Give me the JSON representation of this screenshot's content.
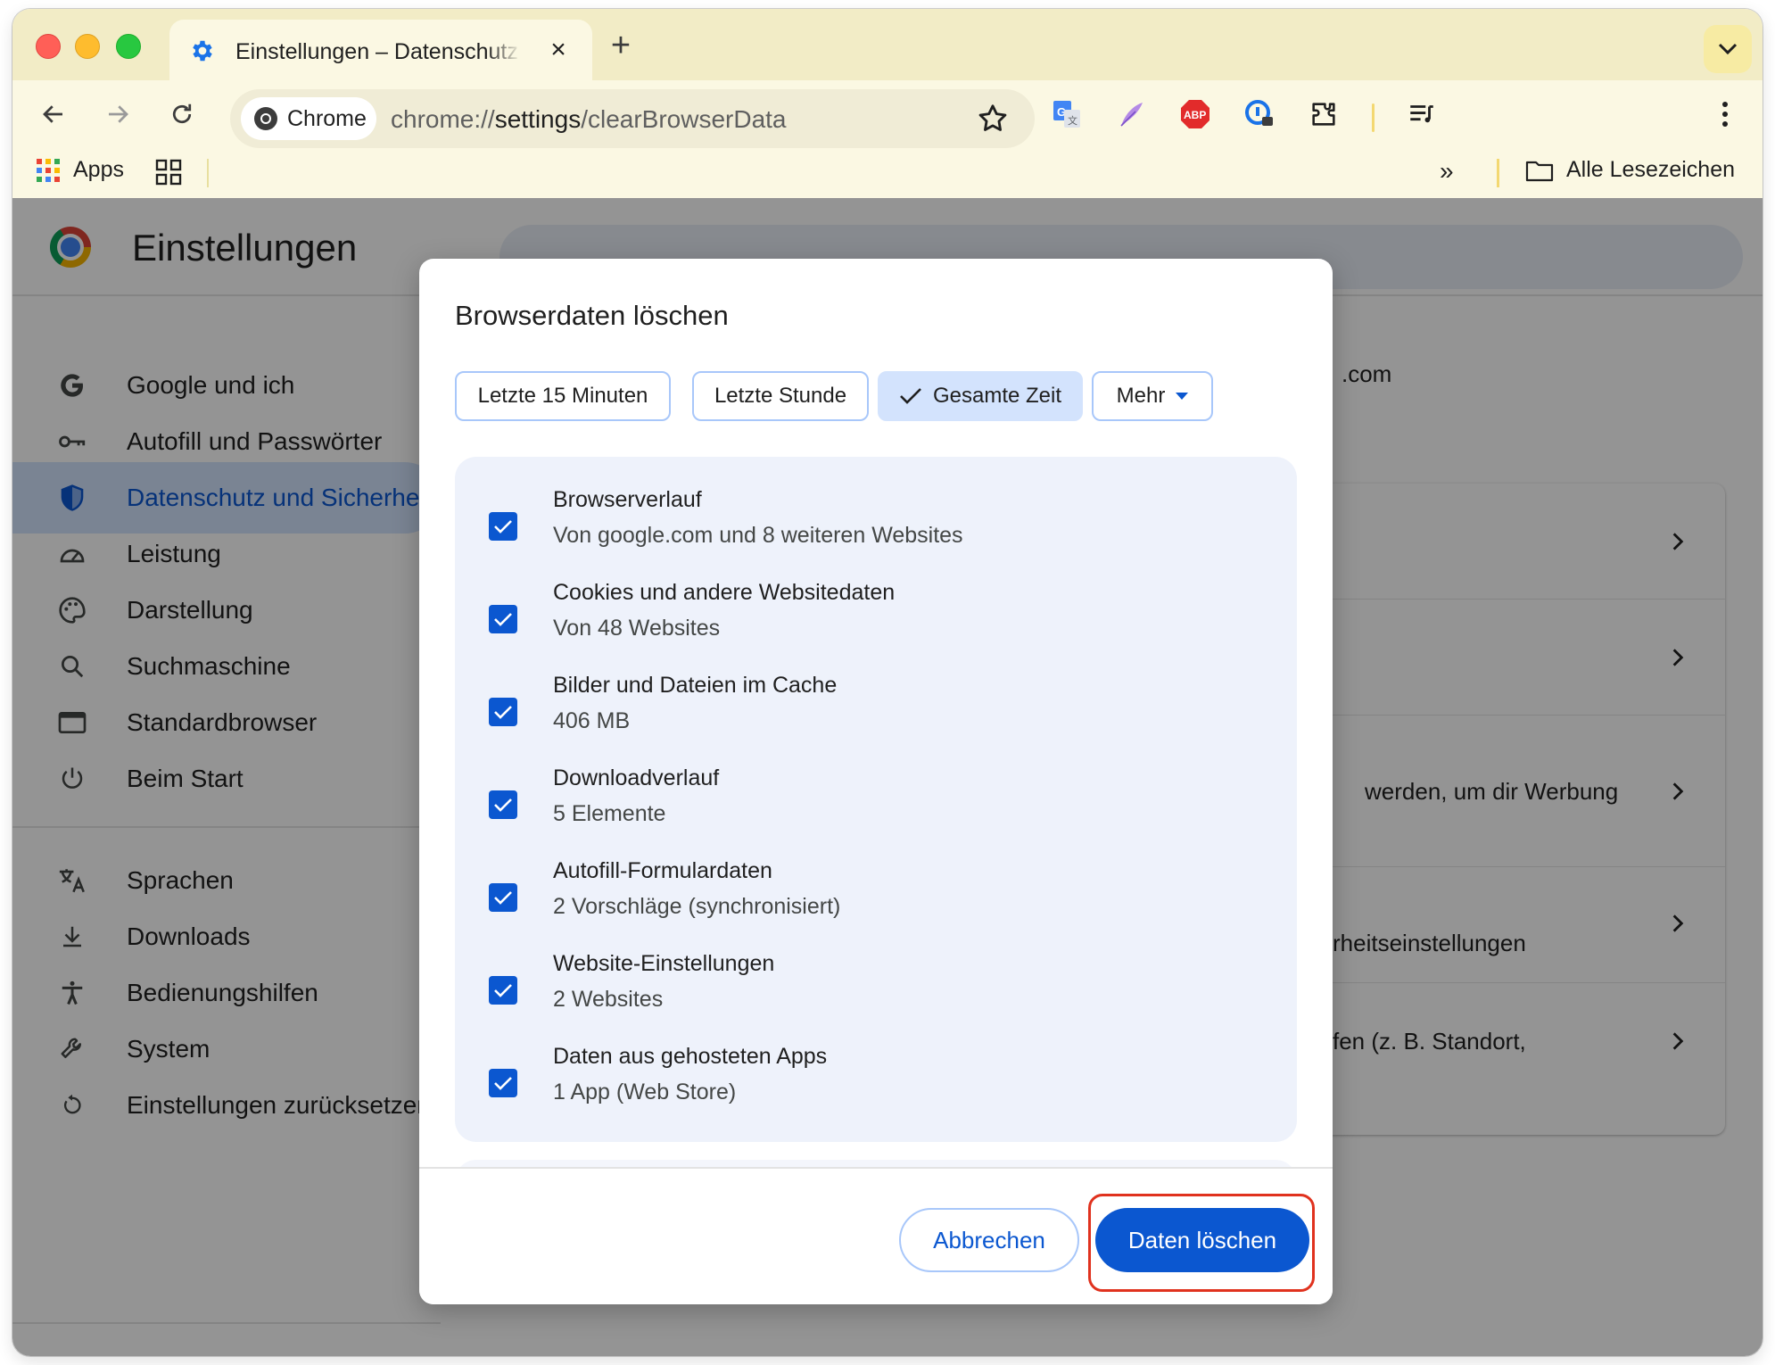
{
  "browser": {
    "tab_title": "Einstellungen – Datenschutz und Sicherheit",
    "omnibox_chip": "Chrome",
    "url_scheme": "chrome://",
    "url_host": "settings",
    "url_path": "/clearBrowserData"
  },
  "bookmarks": {
    "apps_label": "Apps",
    "more_label": "»",
    "all_label": "Alle Lesezeichen"
  },
  "settings": {
    "title": "Einstellungen",
    "nav": [
      {
        "label": "Google und ich"
      },
      {
        "label": "Autofill und Passwörter"
      },
      {
        "label": "Datenschutz und Sicherheit"
      },
      {
        "label": "Leistung"
      },
      {
        "label": "Darstellung"
      },
      {
        "label": "Suchmaschine"
      },
      {
        "label": "Standardbrowser"
      },
      {
        "label": "Beim Start"
      },
      {
        "label": "Sprachen"
      },
      {
        "label": "Downloads"
      },
      {
        "label": "Bedienungshilfen"
      },
      {
        "label": "System"
      },
      {
        "label": "Einstellungen zurücksetzen"
      }
    ],
    "behind_text": {
      "t1": ".com",
      "t2": "werden, um dir Werbung",
      "t3": "rheitseinstellungen",
      "t4": "fen (z. B. Standort,"
    }
  },
  "dialog": {
    "title": "Browserdaten löschen",
    "time_ranges": [
      {
        "label": "Letzte 15 Minuten",
        "selected": false
      },
      {
        "label": "Letzte Stunde",
        "selected": false
      },
      {
        "label": "Gesamte Zeit",
        "selected": true
      },
      {
        "label": "Mehr",
        "selected": false
      }
    ],
    "items": [
      {
        "title": "Browserverlauf",
        "subtitle": "Von google.com und 8 weiteren Websites",
        "checked": true
      },
      {
        "title": "Cookies und andere Websitedaten",
        "subtitle": "Von 48 Websites",
        "checked": true
      },
      {
        "title": "Bilder und Dateien im Cache",
        "subtitle": "406 MB",
        "checked": true
      },
      {
        "title": "Downloadverlauf",
        "subtitle": "5 Elemente",
        "checked": true
      },
      {
        "title": "Autofill-Formulardaten",
        "subtitle": "2 Vorschläge (synchronisiert)",
        "checked": true
      },
      {
        "title": "Website-Einstellungen",
        "subtitle": "2 Websites",
        "checked": true
      },
      {
        "title": "Daten aus gehosteten Apps",
        "subtitle": "1 App (Web Store)",
        "checked": true
      }
    ],
    "cancel_label": "Abbrechen",
    "confirm_label": "Daten löschen"
  },
  "colors": {
    "accent": "#0b57d0",
    "highlight": "#e0321e",
    "tabstrip": "#f2ecc6",
    "toolbar": "#fbf8e3"
  }
}
